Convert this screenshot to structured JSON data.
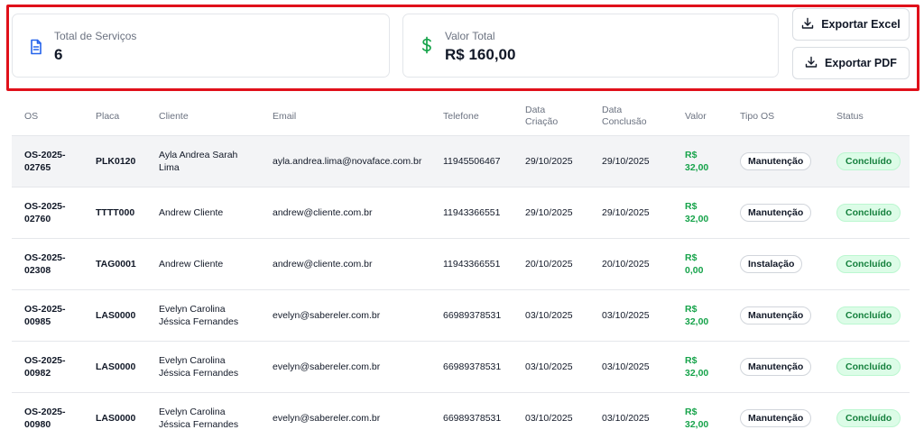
{
  "summary": {
    "services_label": "Total de Serviços",
    "services_value": "6",
    "total_label": "Valor Total",
    "total_value": "R$ 160,00"
  },
  "actions": {
    "export_excel": "Exportar Excel",
    "export_pdf": "Exportar PDF"
  },
  "colors": {
    "highlight": "#e0101a",
    "accent_blue": "#2563eb",
    "accent_green": "#16a34a"
  },
  "table": {
    "headers": {
      "os": "OS",
      "placa": "Placa",
      "cliente": "Cliente",
      "email": "Email",
      "telefone": "Telefone",
      "data_criacao_1": "Data",
      "data_criacao_2": "Criação",
      "data_conclusao_1": "Data",
      "data_conclusao_2": "Conclusão",
      "valor": "Valor",
      "tipo": "Tipo OS",
      "status": "Status"
    },
    "rows": [
      {
        "os1": "OS-2025-",
        "os2": "02765",
        "placa": "PLK0120",
        "cliente1": "Ayla Andrea Sarah",
        "cliente2": "Lima",
        "email": "ayla.andrea.lima@novaface.com.br",
        "telefone": "11945506467",
        "criacao": "29/10/2025",
        "conclusao": "29/10/2025",
        "valor1": "R$",
        "valor2": "32,00",
        "tipo": "Manutenção",
        "status": "Concluído"
      },
      {
        "os1": "OS-2025-",
        "os2": "02760",
        "placa": "TTTT000",
        "cliente1": "Andrew Cliente",
        "cliente2": "",
        "email": "andrew@cliente.com.br",
        "telefone": "11943366551",
        "criacao": "29/10/2025",
        "conclusao": "29/10/2025",
        "valor1": "R$",
        "valor2": "32,00",
        "tipo": "Manutenção",
        "status": "Concluído"
      },
      {
        "os1": "OS-2025-",
        "os2": "02308",
        "placa": "TAG0001",
        "cliente1": "Andrew Cliente",
        "cliente2": "",
        "email": "andrew@cliente.com.br",
        "telefone": "11943366551",
        "criacao": "20/10/2025",
        "conclusao": "20/10/2025",
        "valor1": "R$",
        "valor2": "0,00",
        "tipo": "Instalação",
        "status": "Concluído"
      },
      {
        "os1": "OS-2025-",
        "os2": "00985",
        "placa": "LAS0000",
        "cliente1": "Evelyn Carolina",
        "cliente2": "Jéssica Fernandes",
        "email": "evelyn@sabereler.com.br",
        "telefone": "66989378531",
        "criacao": "03/10/2025",
        "conclusao": "03/10/2025",
        "valor1": "R$",
        "valor2": "32,00",
        "tipo": "Manutenção",
        "status": "Concluído"
      },
      {
        "os1": "OS-2025-",
        "os2": "00982",
        "placa": "LAS0000",
        "cliente1": "Evelyn Carolina",
        "cliente2": "Jéssica Fernandes",
        "email": "evelyn@sabereler.com.br",
        "telefone": "66989378531",
        "criacao": "03/10/2025",
        "conclusao": "03/10/2025",
        "valor1": "R$",
        "valor2": "32,00",
        "tipo": "Manutenção",
        "status": "Concluído"
      },
      {
        "os1": "OS-2025-",
        "os2": "00980",
        "placa": "LAS0000",
        "cliente1": "Evelyn Carolina",
        "cliente2": "Jéssica Fernandes",
        "email": "evelyn@sabereler.com.br",
        "telefone": "66989378531",
        "criacao": "03/10/2025",
        "conclusao": "03/10/2025",
        "valor1": "R$",
        "valor2": "32,00",
        "tipo": "Manutenção",
        "status": "Concluído"
      }
    ]
  }
}
